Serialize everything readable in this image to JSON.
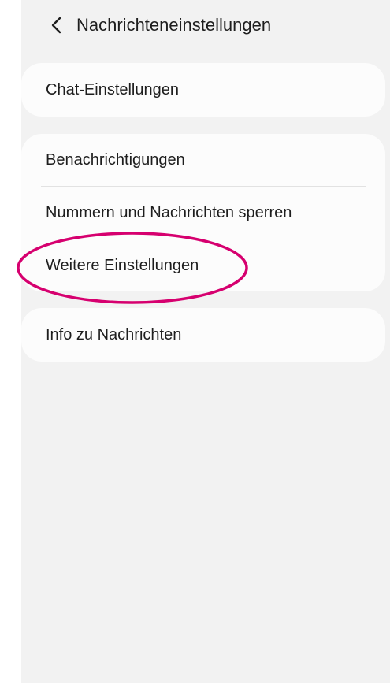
{
  "header": {
    "back_icon": "chevron-left-icon",
    "title": "Nachrichteneinstellungen"
  },
  "settings": {
    "chat": "Chat-Einstellungen",
    "group": [
      "Benachrichtigungen",
      "Nummern und Nachrichten sperren",
      "Weitere Einstellungen"
    ],
    "info": "Info zu Nachrichten"
  },
  "annotation": {
    "highlight_color": "#d6006f"
  }
}
